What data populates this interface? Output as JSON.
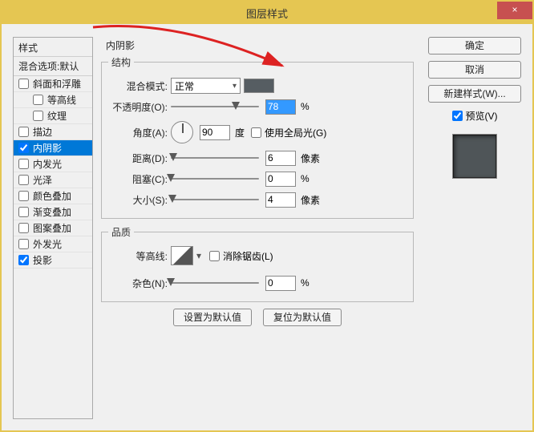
{
  "window": {
    "title": "图层样式",
    "close_icon": "×"
  },
  "sidebar": {
    "header": "样式",
    "subheader": "混合选项:默认",
    "items": [
      {
        "label": "斜面和浮雕",
        "checked": false,
        "child": false
      },
      {
        "label": "等高线",
        "checked": false,
        "child": true
      },
      {
        "label": "纹理",
        "checked": false,
        "child": true
      },
      {
        "label": "描边",
        "checked": false,
        "child": false
      },
      {
        "label": "内阴影",
        "checked": true,
        "child": false,
        "selected": true
      },
      {
        "label": "内发光",
        "checked": false,
        "child": false
      },
      {
        "label": "光泽",
        "checked": false,
        "child": false
      },
      {
        "label": "颜色叠加",
        "checked": false,
        "child": false
      },
      {
        "label": "渐变叠加",
        "checked": false,
        "child": false
      },
      {
        "label": "图案叠加",
        "checked": false,
        "child": false
      },
      {
        "label": "外发光",
        "checked": false,
        "child": false
      },
      {
        "label": "投影",
        "checked": true,
        "child": false
      }
    ]
  },
  "main": {
    "title": "内阴影",
    "structure_legend": "结构",
    "quality_legend": "品质",
    "blend_mode_label": "混合模式:",
    "blend_mode_value": "正常",
    "color_swatch": "#565d62",
    "opacity_label": "不透明度(O):",
    "opacity_value": "78",
    "opacity_unit": "%",
    "angle_label": "角度(A):",
    "angle_value": "90",
    "angle_unit": "度",
    "global_light_label": "使用全局光(G)",
    "distance_label": "距离(D):",
    "distance_value": "6",
    "distance_unit": "像素",
    "choke_label": "阻塞(C):",
    "choke_value": "0",
    "choke_unit": "%",
    "size_label": "大小(S):",
    "size_value": "4",
    "size_unit": "像素",
    "contour_label": "等高线:",
    "antialias_label": "消除锯齿(L)",
    "noise_label": "杂色(N):",
    "noise_value": "0",
    "noise_unit": "%",
    "set_default": "设置为默认值",
    "reset_default": "复位为默认值"
  },
  "right": {
    "ok": "确定",
    "cancel": "取消",
    "new_style": "新建样式(W)...",
    "preview_label": "预览(V)"
  },
  "slider_positions": {
    "opacity": 78,
    "distance": 3,
    "choke": 0,
    "size": 2,
    "noise": 0
  }
}
